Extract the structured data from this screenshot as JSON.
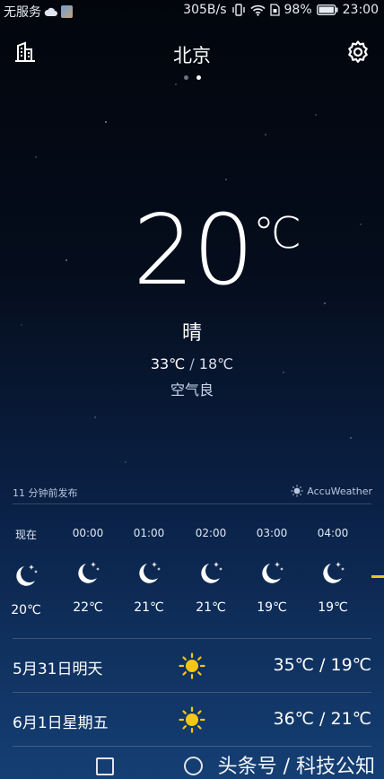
{
  "status_bar": {
    "carrier": "无服务",
    "network_speed": "305B/s",
    "battery": "98%",
    "time": "23:00"
  },
  "header": {
    "city": "北京",
    "left_icon": "city-list-icon",
    "right_icon": "settings-gear-icon"
  },
  "page_indicator": {
    "count": 2,
    "active_index": 1
  },
  "current": {
    "temperature": "20",
    "unit": "℃",
    "condition": "晴",
    "high": "33℃",
    "separator": "/",
    "low": "18℃",
    "air_quality": "空气良"
  },
  "publish": {
    "time_text": "11 分钟前发布",
    "provider": "AccuWeather"
  },
  "hourly": [
    {
      "time": "现在",
      "icon": "moon-stars-icon",
      "temp": "20℃"
    },
    {
      "time": "00:00",
      "icon": "moon-stars-icon",
      "temp": "22℃"
    },
    {
      "time": "01:00",
      "icon": "moon-stars-icon",
      "temp": "21℃"
    },
    {
      "time": "02:00",
      "icon": "moon-stars-icon",
      "temp": "21℃"
    },
    {
      "time": "03:00",
      "icon": "moon-stars-icon",
      "temp": "19℃"
    },
    {
      "time": "04:00",
      "icon": "moon-stars-icon",
      "temp": "19℃"
    }
  ],
  "daily": [
    {
      "date": "5月31日明天",
      "icon": "sun-icon",
      "temps": "35℃ / 19℃"
    },
    {
      "date": "6月1日星期五",
      "icon": "sun-icon",
      "temps": "36℃ / 21℃"
    }
  ],
  "watermark": "头条号 / 科技公知",
  "colors": {
    "sun": "#f7c614",
    "divider": "rgba(255,255,255,0.18)",
    "background_top": "#02050c",
    "background_bottom": "#153f74"
  }
}
